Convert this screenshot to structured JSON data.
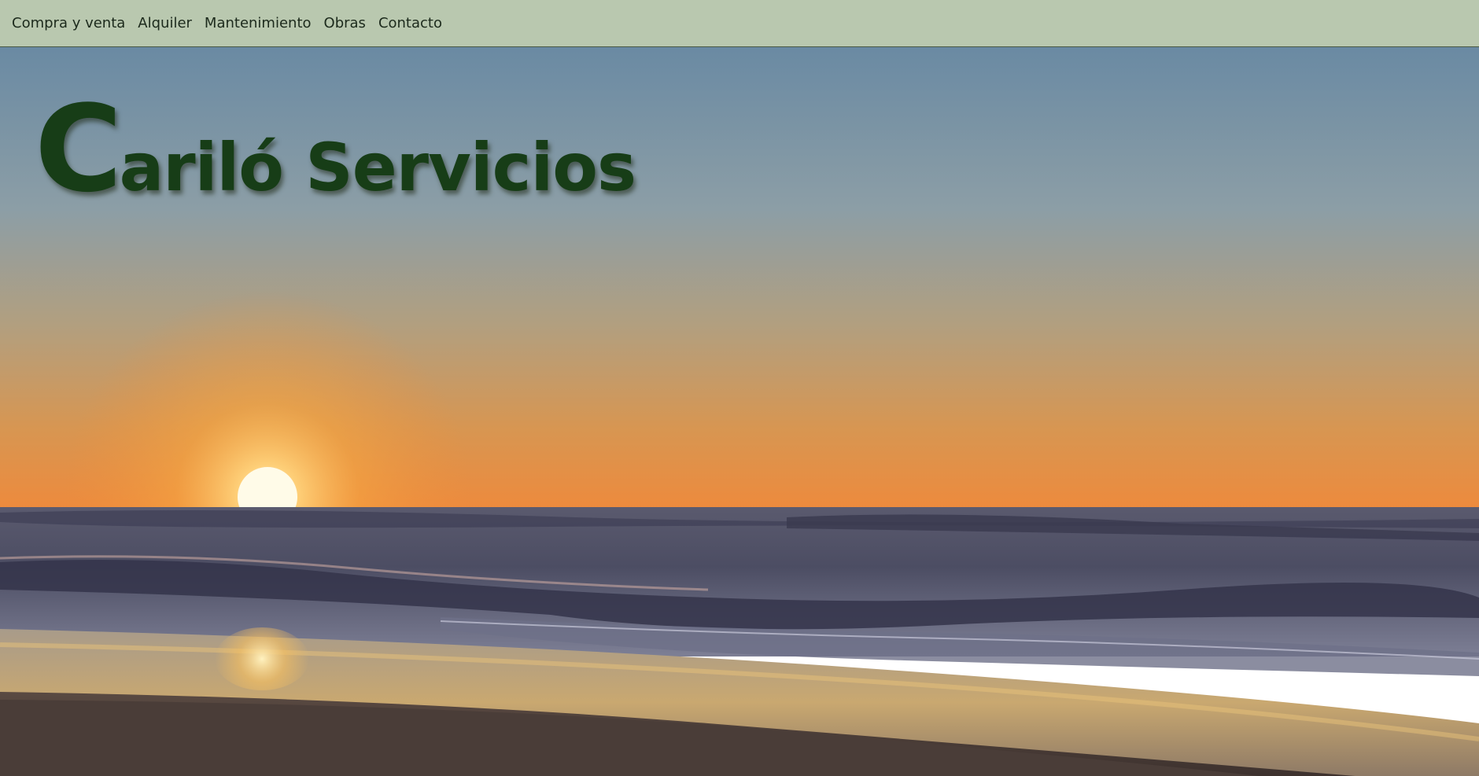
{
  "nav": {
    "items": [
      {
        "label": "Compra y venta"
      },
      {
        "label": "Alquiler"
      },
      {
        "label": "Mantenimiento"
      },
      {
        "label": "Obras"
      },
      {
        "label": "Contacto"
      }
    ]
  },
  "hero": {
    "title_initial": "C",
    "title_rest": "ariló Servicios",
    "image_description_icon": "sunset-beach-photo"
  },
  "colors": {
    "navbar_bg": "#b9c8af",
    "title_text": "#173d17",
    "nav_text": "#1c2a1c"
  }
}
